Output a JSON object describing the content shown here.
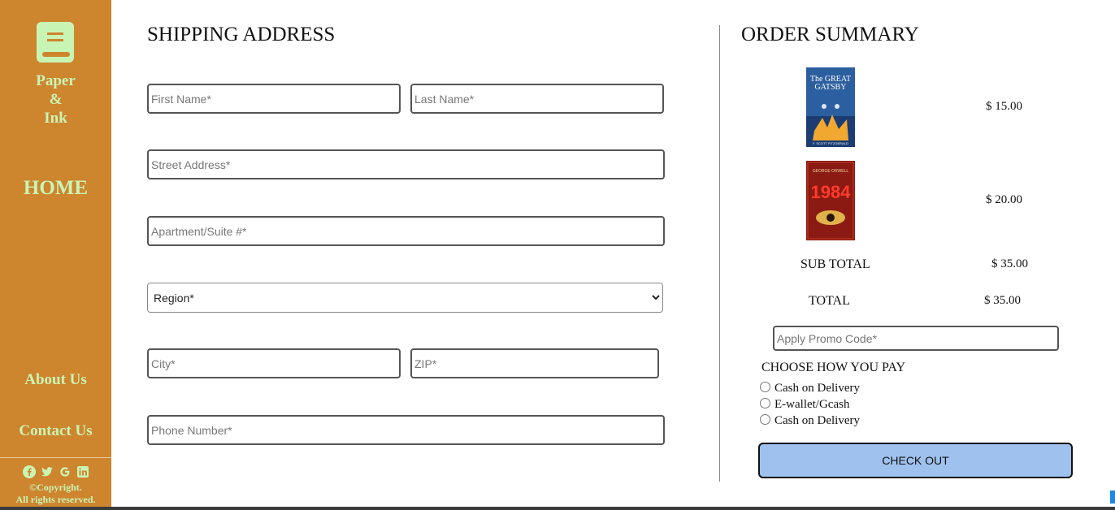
{
  "brand": {
    "line1": "Paper",
    "line2": "&",
    "line3": "Ink"
  },
  "nav": {
    "home": "HOME",
    "about": "About Us",
    "contact": "Contact Us"
  },
  "footer": {
    "copyright": "©Copyright.",
    "rights": "All rights reserved."
  },
  "social_icons": [
    "facebook-icon",
    "twitter-icon",
    "google-icon",
    "linkedin-icon"
  ],
  "shipping": {
    "title": "SHIPPING ADDRESS",
    "first_name": "First Name*",
    "last_name": "Last Name*",
    "street": "Street Address*",
    "apartment": "Apartment/Suite #*",
    "region": "Region*",
    "city": "City*",
    "zip": "ZIP*",
    "phone": "Phone Number*"
  },
  "summary": {
    "title": "ORDER SUMMARY",
    "items": [
      {
        "book_title_top": "The GREAT",
        "book_title_bottom": "GATSBY",
        "author": "F. SCOTT FITZGERALD",
        "price": "$ 15.00"
      },
      {
        "book_author": "GEORGE ORWELL",
        "book_title": "1984",
        "price": "$ 20.00"
      }
    ],
    "subtotal_label": "SUB TOTAL",
    "subtotal_value": "$ 35.00",
    "total_label": "TOTAL",
    "total_value": "$ 35.00",
    "promo_placeholder": "Apply Promo Code*",
    "pay_title": "CHOOSE HOW YOU PAY",
    "pay_options": [
      "Cash on Delivery",
      "E-wallet/Gcash",
      "Cash on Delivery"
    ],
    "checkout": "CHECK OUT"
  },
  "colors": {
    "sidebar": "#cd852e",
    "sidebar_text": "#c9f5b4",
    "checkout_bg": "#9ec1ee"
  }
}
